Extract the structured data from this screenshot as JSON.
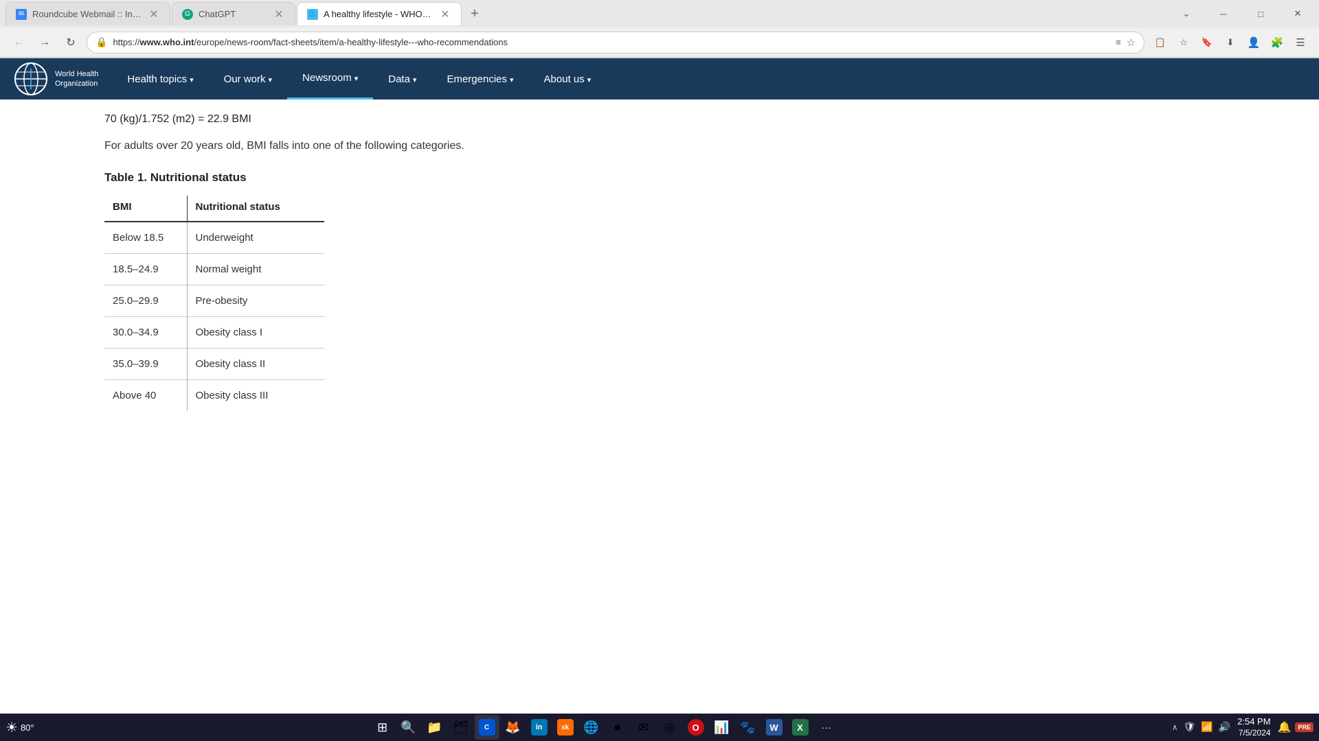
{
  "browser": {
    "tabs": [
      {
        "id": "roundcube",
        "title": "Roundcube Webmail :: Inbox",
        "favicon_color": "#3b82f6",
        "favicon_char": "✉",
        "active": false
      },
      {
        "id": "chatgpt",
        "title": "ChatGPT",
        "favicon_color": "#10a37f",
        "favicon_char": "⬡",
        "active": false
      },
      {
        "id": "who",
        "title": "A healthy lifestyle - WHO recom...",
        "favicon_color": "#4db8e8",
        "favicon_char": "🌐",
        "active": true
      }
    ],
    "url": "https://www.who.int/europe/news-room/fact-sheets/item/a-healthy-lifestyle---who-recommendations",
    "url_protocol": "https://",
    "url_domain": "www.who.int",
    "url_path": "/europe/news-room/fact-sheets/item/a-healthy-lifestyle---who-recommendations"
  },
  "navbar": {
    "logo_line1": "World Health",
    "logo_line2": "Organization",
    "items": [
      {
        "id": "health-topics",
        "label": "Health topics",
        "has_dropdown": true,
        "active": false
      },
      {
        "id": "our-work",
        "label": "Our work",
        "has_dropdown": true,
        "active": false
      },
      {
        "id": "newsroom",
        "label": "Newsroom",
        "has_dropdown": true,
        "active": true
      },
      {
        "id": "data",
        "label": "Data",
        "has_dropdown": true,
        "active": false
      },
      {
        "id": "emergencies",
        "label": "Emergencies",
        "has_dropdown": true,
        "active": false
      },
      {
        "id": "about-us",
        "label": "About us",
        "has_dropdown": true,
        "active": false
      }
    ]
  },
  "page": {
    "bmi_formula": "70 (kg)/1.752 (m2) = 22.9 BMI",
    "intro_text": "For adults over 20 years old, BMI falls into one of the following categories.",
    "table_title": "Table 1. Nutritional status",
    "table_headers": [
      "BMI",
      "Nutritional status"
    ],
    "table_rows": [
      {
        "bmi": "Below 18.5",
        "status": "Underweight"
      },
      {
        "bmi": "18.5–24.9",
        "status": "Normal weight"
      },
      {
        "bmi": "25.0–29.9",
        "status": "Pre-obesity"
      },
      {
        "bmi": "30.0–34.9",
        "status": "Obesity class I"
      },
      {
        "bmi": "35.0–39.9",
        "status": "Obesity class II"
      },
      {
        "bmi": "Above 40",
        "status": "Obesity class III"
      }
    ]
  },
  "taskbar": {
    "weather": "80°",
    "apps": [
      {
        "id": "start",
        "icon": "⊞",
        "label": "Start"
      },
      {
        "id": "search",
        "icon": "🔍",
        "label": "Search"
      },
      {
        "id": "file-explorer",
        "icon": "📁",
        "label": "File Explorer"
      },
      {
        "id": "files",
        "icon": "🗂",
        "label": "Files"
      },
      {
        "id": "coursera",
        "icon": "🎓",
        "label": "Coursera"
      },
      {
        "id": "firefox",
        "icon": "🦊",
        "label": "Firefox"
      },
      {
        "id": "linkedin",
        "icon": "in",
        "label": "LinkedIn"
      },
      {
        "id": "sk",
        "icon": "Sk",
        "label": "SK App"
      },
      {
        "id": "edge",
        "icon": "e",
        "label": "Edge"
      },
      {
        "id": "video",
        "icon": "▶",
        "label": "Video"
      },
      {
        "id": "mail",
        "icon": "✉",
        "label": "Mail"
      },
      {
        "id": "chrome",
        "icon": "◎",
        "label": "Chrome"
      },
      {
        "id": "opera",
        "icon": "O",
        "label": "Opera"
      },
      {
        "id": "power-bi",
        "icon": "📊",
        "label": "Power BI"
      },
      {
        "id": "app15",
        "icon": "🐾",
        "label": "App15"
      },
      {
        "id": "word",
        "icon": "W",
        "label": "Word"
      },
      {
        "id": "excel",
        "icon": "X",
        "label": "Excel"
      },
      {
        "id": "more",
        "icon": "•••",
        "label": "More"
      }
    ],
    "clock_time": "2:54 PM",
    "clock_date": "7/5/2024"
  }
}
